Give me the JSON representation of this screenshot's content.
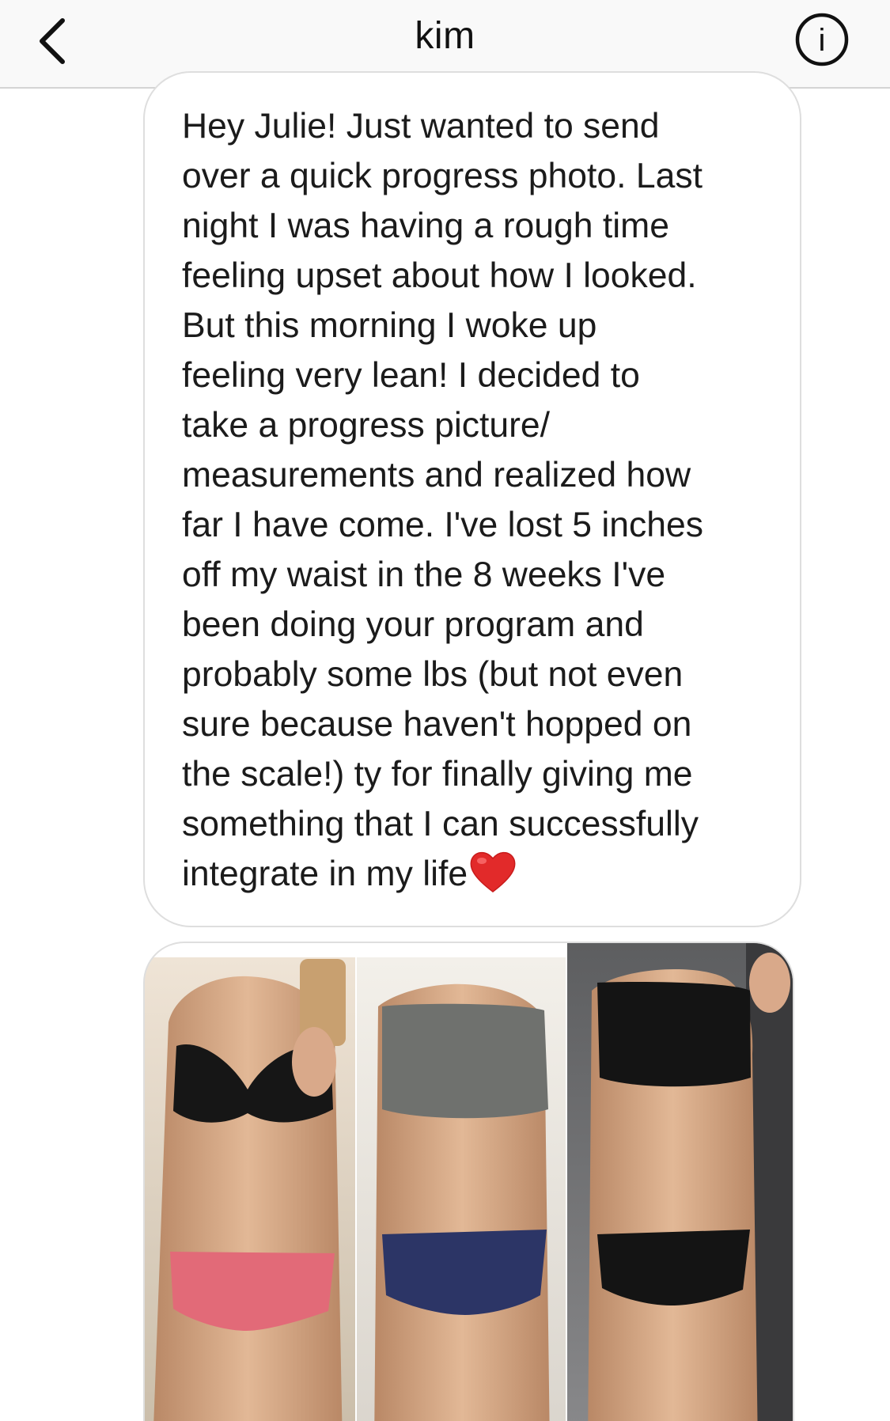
{
  "header": {
    "title": "kim",
    "back_icon": "chevron-left-icon",
    "info_icon": "info-circle-icon",
    "info_glyph": "i"
  },
  "message": {
    "text": "Hey Julie! Just wanted to send\nover a quick progress photo. Last\nnight I was having a rough time\nfeeling upset about how I looked.\nBut this morning I woke up\nfeeling very lean! I decided to\ntake a progress picture/\nmeasurements and realized how\nfar I have come. I've lost 5 inches\noff my waist in the 8 weeks I've\nbeen doing your program and\nprobably some lbs (but not even\nsure because haven't hopped on\nthe scale!) ty for finally giving me\nsomething that I can successfully\nintegrate in my life",
    "emoji": "red-heart-icon"
  },
  "photo": {
    "panels": 3,
    "accent_colors": {
      "panel1_bottom": "#e26a78",
      "panel2_top": "#6f716e",
      "panel2_bottom": "#2c3566",
      "panel3_set": "#141414"
    }
  }
}
